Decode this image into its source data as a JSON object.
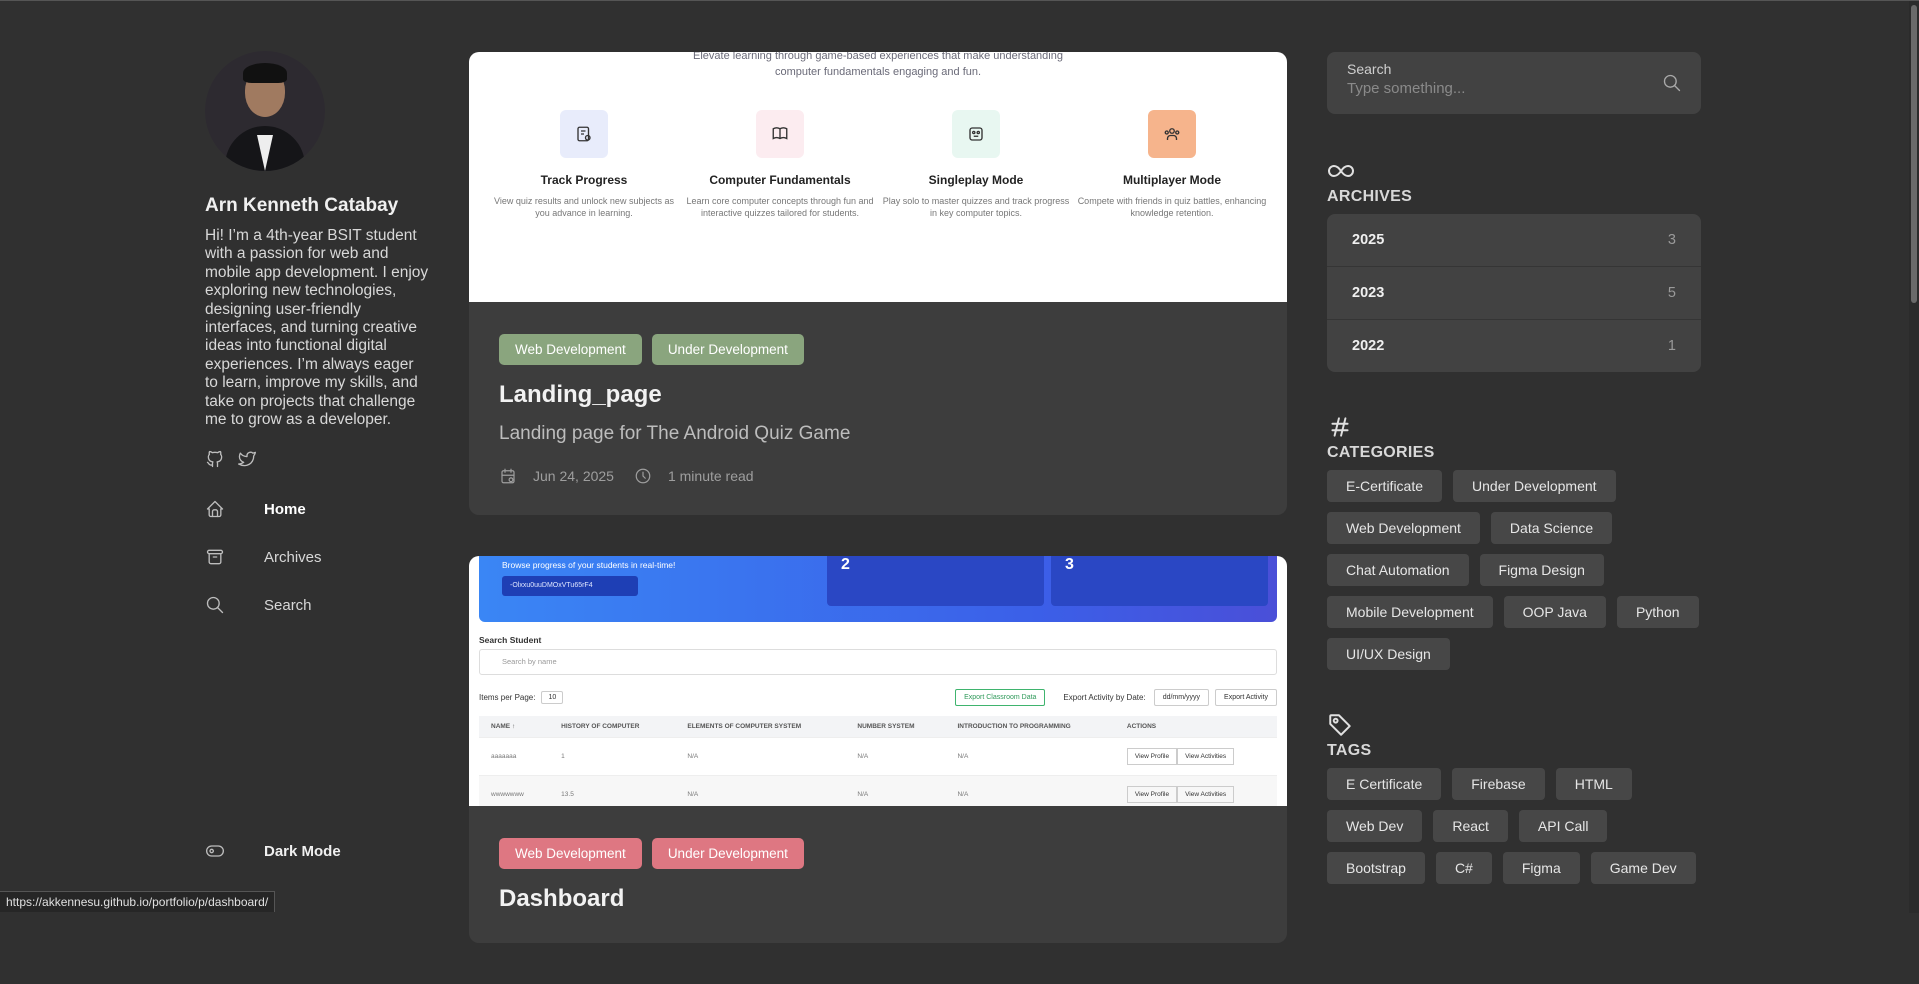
{
  "sidebar": {
    "author_name": "Arn Kenneth Catabay",
    "bio": "Hi! I’m a 4th-year BSIT student with a passion for web and mobile app development. I enjoy exploring new technologies, designing user-friendly interfaces, and turning creative ideas into functional digital experiences. I’m always eager to learn, improve my skills, and take on projects that challenge me to grow as a developer.",
    "social_icons": [
      "github-icon",
      "twitter-icon"
    ],
    "nav": [
      {
        "label": "Home",
        "icon": "home-icon",
        "active": true
      },
      {
        "label": "Archives",
        "icon": "archive-icon"
      },
      {
        "label": "Search",
        "icon": "search-icon"
      }
    ],
    "dark_mode_label": "Dark Mode"
  },
  "posts": [
    {
      "badges": [
        "Web Development",
        "Under Development"
      ],
      "badge_color": "#8aa57e",
      "title": "Landing_page",
      "description": "Landing page for The Android Quiz Game",
      "date": "Jun 24, 2025",
      "read_time": "1 minute read",
      "preview": {
        "tagline_line1": "Elevate learning through game-based experiences that make understanding",
        "tagline_line2": "computer fundamentals engaging and fun.",
        "features": [
          {
            "title": "Track Progress",
            "desc": "View quiz results and unlock new subjects as you advance in learning."
          },
          {
            "title": "Computer Fundamentals",
            "desc": "Learn core computer concepts through fun and interactive quizzes tailored for students."
          },
          {
            "title": "Singleplay Mode",
            "desc": "Play solo to master quizzes and track progress in key computer topics."
          },
          {
            "title": "Multiplayer Mode",
            "desc": "Compete with friends in quiz battles, enhancing knowledge retention."
          }
        ]
      }
    },
    {
      "badges": [
        "Web Development",
        "Under Development"
      ],
      "badge_color": "#de7782",
      "title": "Dashboard",
      "preview": {
        "banner_text": "Browse progress of your students in real-time!",
        "code_text": "-Olxxu0uuDMOxVTu65rF4",
        "stat_1": "2",
        "stat_2": "3",
        "search_title": "Search Student",
        "search_placeholder": "Search by name",
        "items_per_page_label": "Items per Page:",
        "items_per_page_value": "10",
        "export_classroom": "Export Classroom Data",
        "export_date_label": "Export Activity by Date:",
        "date_placeholder": "dd/mm/yyyy",
        "export_activity": "Export Activity",
        "columns": [
          "NAME ↑",
          "HISTORY OF COMPUTER",
          "ELEMENTS OF COMPUTER SYSTEM",
          "NUMBER SYSTEM",
          "INTRODUCTION TO PROGRAMMING",
          "ACTIONS"
        ],
        "rows": [
          [
            "aaaaaaa",
            "1",
            "N/A",
            "N/A",
            "N/A"
          ],
          [
            "wwwwwww",
            "13.5",
            "N/A",
            "N/A",
            "N/A"
          ]
        ],
        "view_profile": "View Profile",
        "view_activities": "View Activities"
      }
    }
  ],
  "search": {
    "label": "Search",
    "placeholder": "Type something..."
  },
  "archives": {
    "title": "ARCHIVES",
    "icon": "infinity-icon",
    "years": [
      {
        "year": "2025",
        "count": "3"
      },
      {
        "year": "2023",
        "count": "5"
      },
      {
        "year": "2022",
        "count": "1"
      }
    ]
  },
  "categories": {
    "title": "CATEGORIES",
    "icon": "hash-icon",
    "items": [
      "E-Certificate",
      "Under Development",
      "Web Development",
      "Data Science",
      "Chat Automation",
      "Figma Design",
      "Mobile Development",
      "OOP Java",
      "Python",
      "UI/UX Design"
    ]
  },
  "tags": {
    "title": "TAGS",
    "icon": "tag-icon",
    "items": [
      "E Certificate",
      "Firebase",
      "HTML",
      "Web Dev",
      "React",
      "API Call",
      "Bootstrap",
      "C#",
      "Figma",
      "Game Dev"
    ]
  },
  "status_bar": {
    "url": "https://akkennesu.github.io/portfolio/p/dashboard/"
  }
}
